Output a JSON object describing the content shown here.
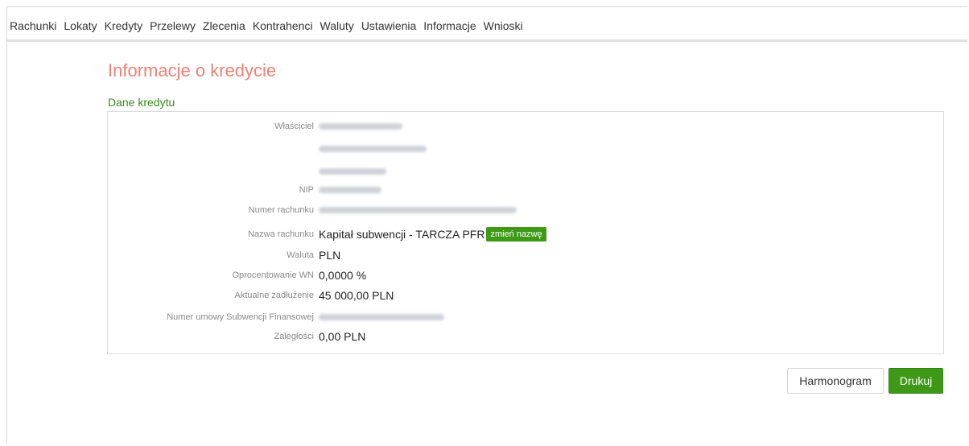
{
  "nav": {
    "items": [
      {
        "label": "Rachunki"
      },
      {
        "label": "Lokaty"
      },
      {
        "label": "Kredyty"
      },
      {
        "label": "Przelewy"
      },
      {
        "label": "Zlecenia"
      },
      {
        "label": "Kontrahenci"
      },
      {
        "label": "Waluty"
      },
      {
        "label": "Ustawienia"
      },
      {
        "label": "Informacje"
      },
      {
        "label": "Wnioski"
      }
    ]
  },
  "page": {
    "title": "Informacje o kredycie",
    "section_label": "Dane kredytu"
  },
  "details": {
    "owner_label": "Właściciel",
    "nip_label": "NIP",
    "account_number_label": "Numer rachunku",
    "account_name_label": "Nazwa rachunku",
    "account_name_value": "Kapitał subwencji - TARCZA PFR",
    "rename_button_label": "zmień nazwę",
    "currency_label": "Waluta",
    "currency_value": "PLN",
    "interest_label": "Oprocentowanie WN",
    "interest_value": "0,0000 %",
    "debt_label": "Aktualne zadłużenie",
    "debt_value": "45 000,00 PLN",
    "agreement_label": "Numer umowy Subwencji Finansowej",
    "arrears_label": "Zaległości",
    "arrears_value": "0,00 PLN"
  },
  "actions": {
    "schedule_label": "Harmonogram",
    "print_label": "Drukuj"
  },
  "colors": {
    "title": "#f08070",
    "accent_green": "#3e9a16",
    "section_green": "#3a8a1a"
  }
}
